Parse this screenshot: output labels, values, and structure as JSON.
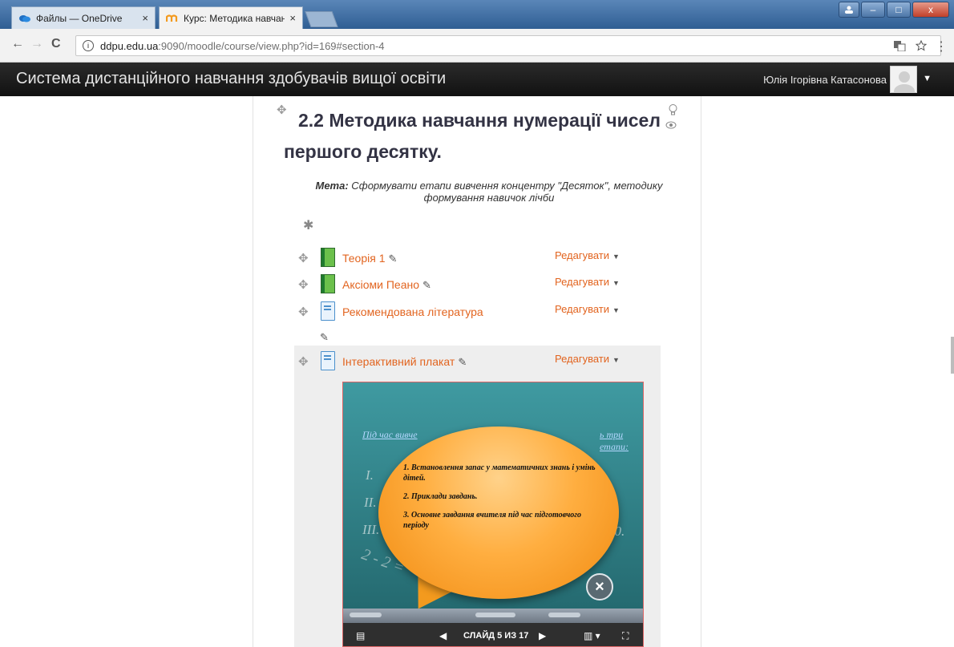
{
  "browser": {
    "tabs": [
      {
        "label": "Файлы — OneDrive",
        "close": "×"
      },
      {
        "label": "Курс: Методика навчанн",
        "close": "×"
      }
    ],
    "back": "←",
    "forward": "→",
    "reload": "C",
    "url_info": "i",
    "url_host": "ddpu.edu.ua",
    "url_path": ":9090/moodle/course/view.php?id=169#section-4",
    "menu": "⋮",
    "window": {
      "minimize": "–",
      "maximize": "□",
      "close": "x"
    }
  },
  "header": {
    "site_title": "Система дистанційного навчання здобувачів вищої освіти",
    "user_name": "Юлія Ігорівна Катасонова",
    "user_caret": "▼"
  },
  "section": {
    "title_line1": "2.2 Методика навчання нумерації чисел",
    "title_line2": "першого десятку.",
    "goal_label": "Мета:",
    "goal_text": " Сформувати етапи вивчення концентру \"Десяток\", методику формування навичок лічби",
    "activities": [
      {
        "label": "Теорія 1",
        "edit": "Редагувати",
        "icon": "book-icon"
      },
      {
        "label": "Аксіоми Пеано",
        "edit": "Редагувати",
        "icon": "book-icon"
      },
      {
        "label": "Рекомендована література",
        "edit": "Редагувати",
        "icon": "file-icon"
      },
      {
        "label": "Інтерактивний плакат",
        "edit": "Редагувати",
        "icon": "file-icon"
      }
    ]
  },
  "slide": {
    "heading_left": "Під час вивче",
    "heading_right": "ь три етапи:",
    "roman": [
      "I.",
      "II.",
      "III."
    ],
    "right_number": "10.",
    "chalk": "2 - 2 =",
    "items": [
      "1.  Встановлення запас у математичних знань і умінь дітей.",
      "2. Приклади завдань.",
      "3. Основне завдання вчителя під час підготовчого періоду"
    ],
    "close": "×",
    "counter": "СЛАЙД 5 ИЗ 17"
  },
  "colors": {
    "link": "#e2641f",
    "moodle_bar": "#1a1a1a",
    "slide_bg": "#2c7a80",
    "bubble": "#f39a1e"
  }
}
